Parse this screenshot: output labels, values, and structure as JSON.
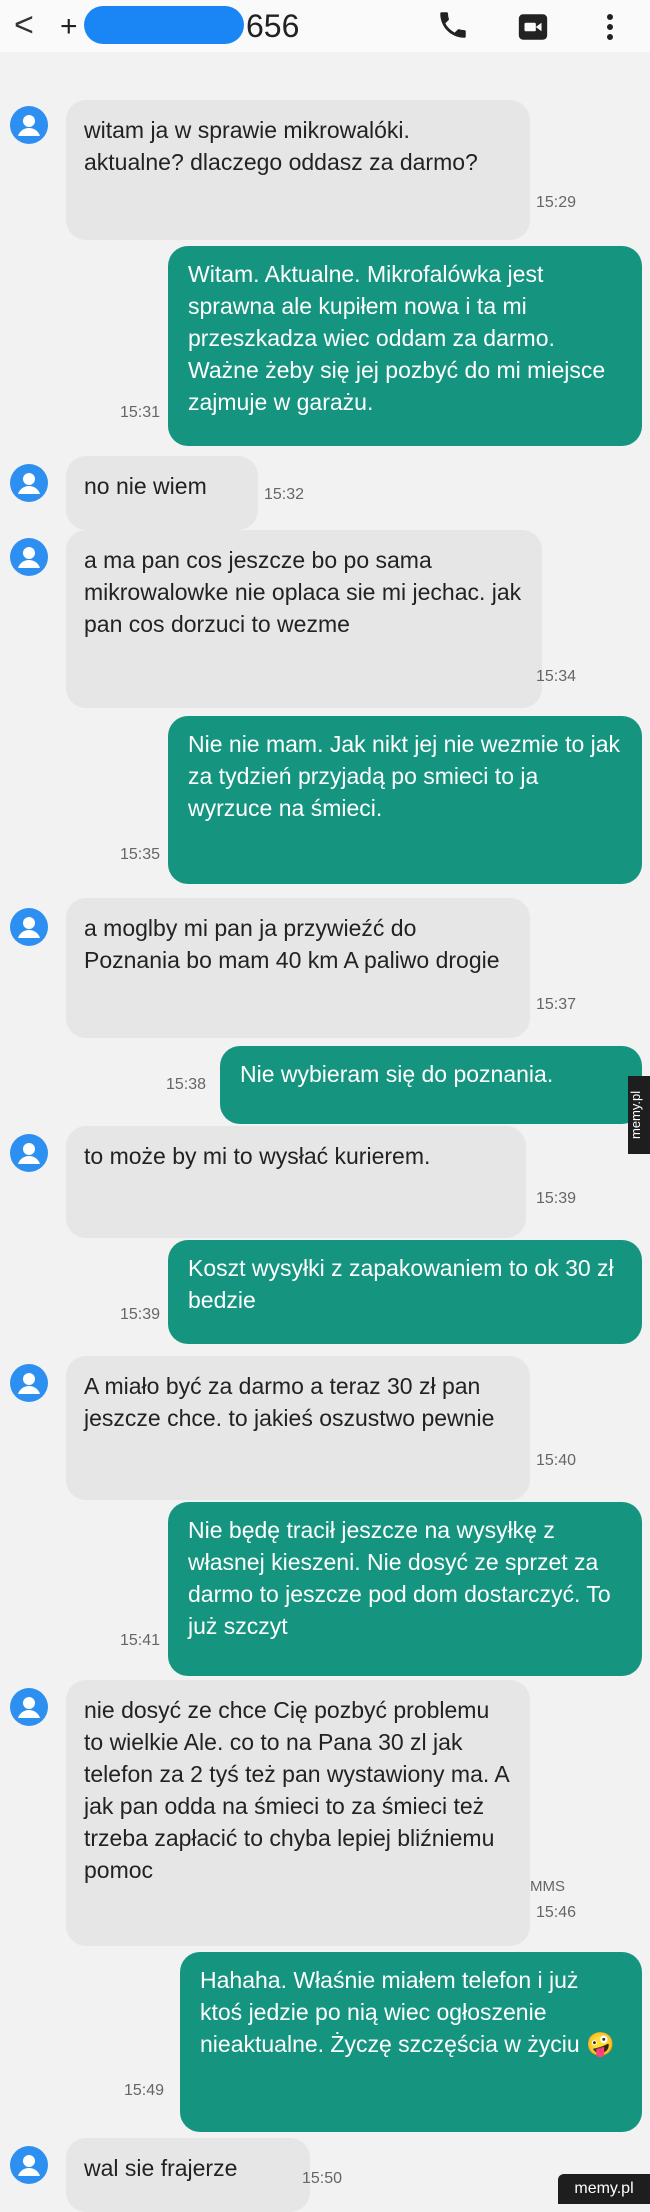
{
  "header": {
    "back_glyph": "<",
    "plus": "+",
    "number_tail": "656"
  },
  "colors": {
    "outgoing": "#159580",
    "incoming": "#e6e6e6",
    "avatar": "#2d8ff0",
    "redaction": "#1a86f5"
  },
  "messages": [
    {
      "dir": "in",
      "text": "witam ja w sprawie mikrowalóki. aktualne? dlaczego oddasz za darmo?",
      "time": "15:29"
    },
    {
      "dir": "out",
      "text": "Witam. Aktualne. Mikrofalówka jest sprawna ale kupiłem nowa i ta mi przeszkadza wiec oddam za darmo. Ważne żeby się jej pozbyć do mi miejsce zajmuje w garażu.",
      "time": "15:31"
    },
    {
      "dir": "in",
      "text": "no nie wiem",
      "time": "15:32"
    },
    {
      "dir": "in",
      "text": "a ma pan cos jeszcze bo po sama mikrowalowke nie oplaca sie mi jechac. jak pan cos dorzuci to wezme",
      "time": "15:34"
    },
    {
      "dir": "out",
      "text": "Nie nie mam. Jak nikt jej nie wezmie to jak za tydzień przyjadą po smieci to ja wyrzuce na śmieci.",
      "time": "15:35"
    },
    {
      "dir": "in",
      "text": "a moglby mi pan ja przywieźć do Poznania bo mam 40 km A paliwo drogie",
      "time": "15:37"
    },
    {
      "dir": "out",
      "text": "Nie wybieram się do poznania.",
      "time": "15:38"
    },
    {
      "dir": "in",
      "text": "to może by mi to wysłać kurierem.",
      "time": "15:39"
    },
    {
      "dir": "out",
      "text": "Koszt wysyłki z zapakowaniem to ok 30 zł bedzie",
      "time": "15:39"
    },
    {
      "dir": "in",
      "text": " A miało być za darmo a teraz 30 zł pan jeszcze chce. to jakieś oszustwo pewnie",
      "time": "15:40"
    },
    {
      "dir": "out",
      "text": "Nie będę tracił jeszcze na wysyłkę z własnej kieszeni. Nie dosyć ze sprzet za darmo to jeszcze pod dom dostarczyć. To już szczyt",
      "time": "15:41"
    },
    {
      "dir": "in",
      "text": "nie dosyć ze chce Cię pozbyć problemu to wielkie Ale. co to na Pana 30 zl jak telefon za 2 tyś też pan wystawiony ma. A jak pan odda na śmieci to za śmieci też trzeba zapłacić to chyba lepiej bliźniemu pomoc",
      "time": "15:46",
      "tag": "MMS"
    },
    {
      "dir": "out",
      "text": "Hahaha. Właśnie miałem telefon i już ktoś jedzie po nią wiec ogłoszenie nieaktualne. Życzę szczęścia w życiu 🤪",
      "time": "15:49"
    },
    {
      "dir": "in",
      "text": "wal sie frajerze",
      "time": "15:50"
    }
  ],
  "watermark": {
    "side": "memy.pl",
    "corner": "memy.pl"
  }
}
